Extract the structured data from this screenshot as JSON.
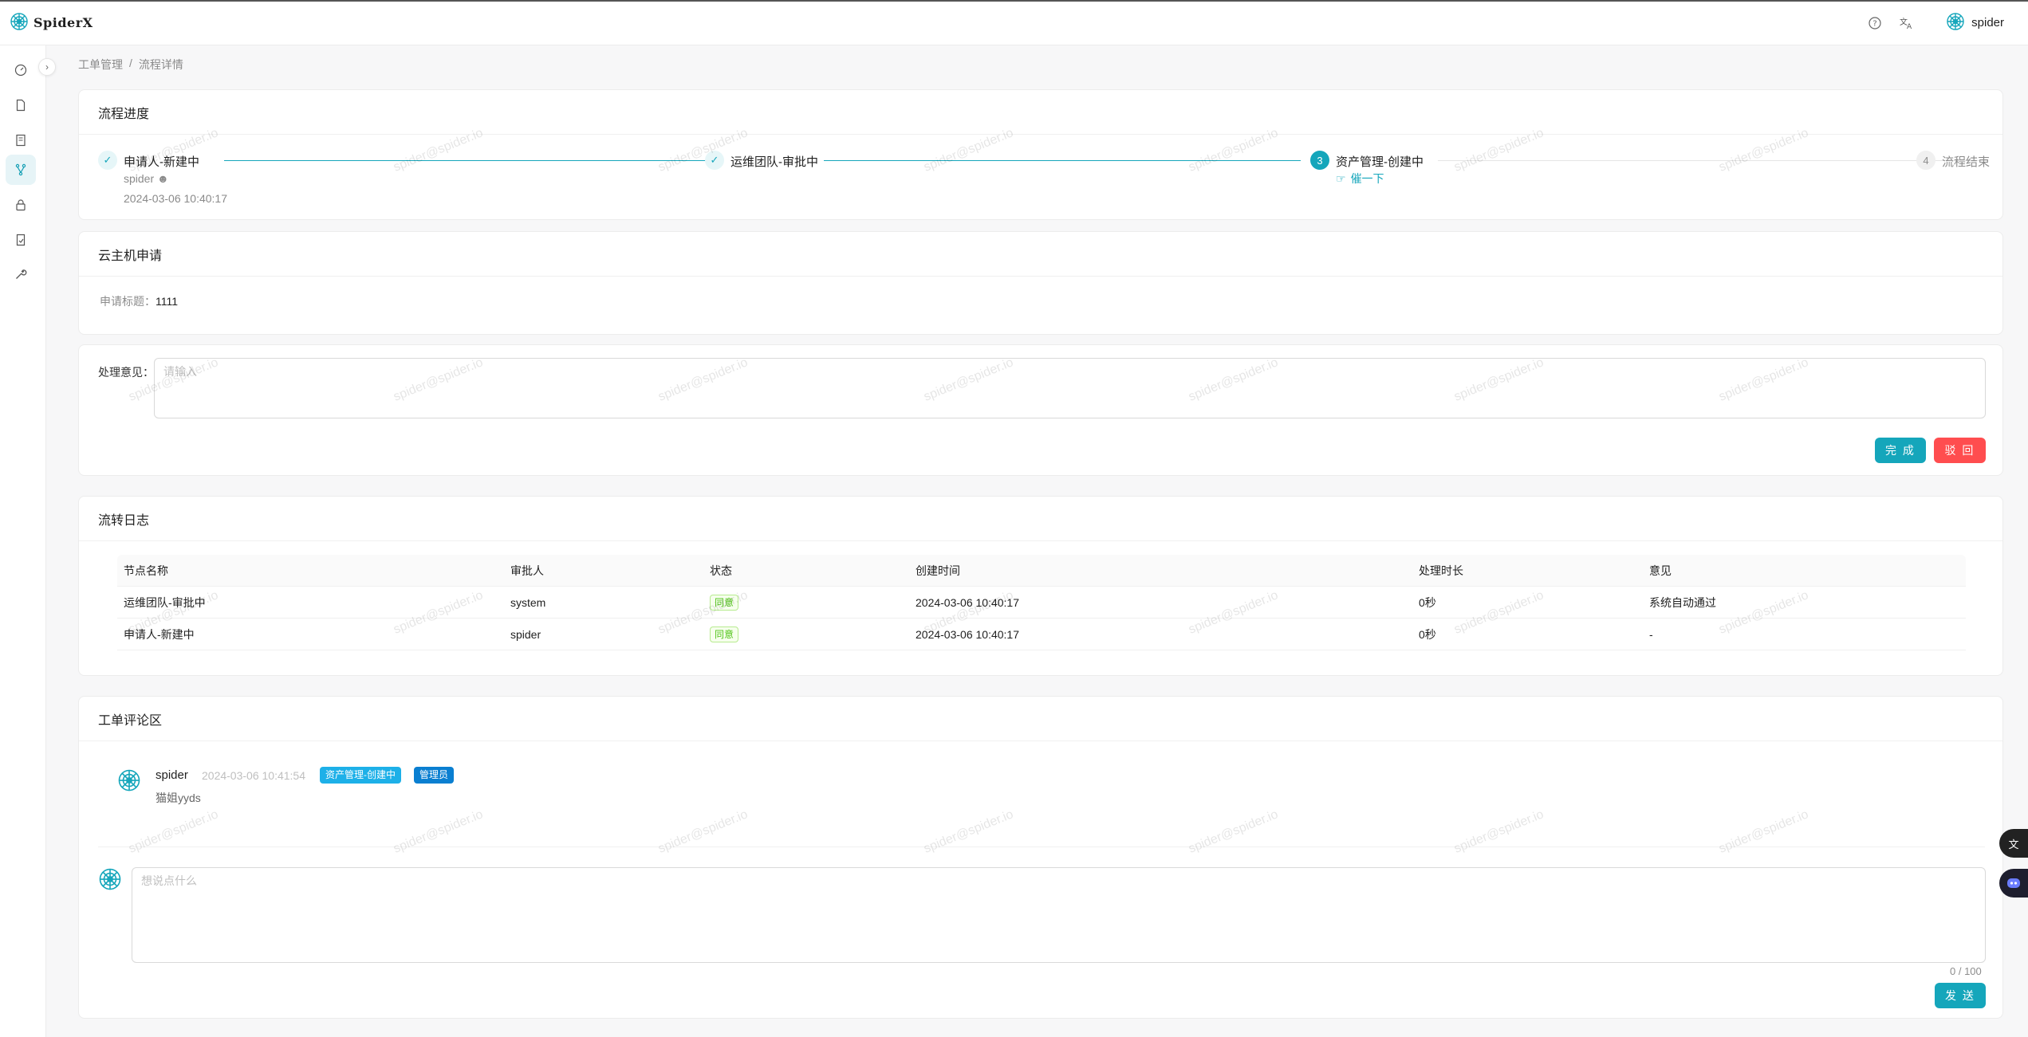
{
  "app": {
    "brand": "SpiderX",
    "user": "spider"
  },
  "breadcrumb": [
    "工单管理",
    "流程详情"
  ],
  "progress": {
    "title": "流程进度",
    "steps": [
      {
        "title": "申请人-新建中",
        "user": "spider",
        "time": "2024-03-06 10:40:17"
      },
      {
        "title": "运维团队-审批中"
      },
      {
        "number": "3",
        "title": "资产管理-创建中",
        "action": "催一下"
      },
      {
        "number": "4",
        "title": "流程结束"
      }
    ]
  },
  "application": {
    "title": "云主机申请",
    "field_label": "申请标题：",
    "field_value": "1111"
  },
  "opinion": {
    "label": "处理意见：",
    "placeholder": "请输入",
    "complete": "完 成",
    "reject": "驳 回"
  },
  "log": {
    "title": "流转日志",
    "columns": [
      "节点名称",
      "审批人",
      "状态",
      "创建时间",
      "处理时长",
      "意见"
    ],
    "rows": [
      [
        "运维团队-审批中",
        "system",
        "同意",
        "2024-03-06 10:40:17",
        "0秒",
        "系统自动通过"
      ],
      [
        "申请人-新建中",
        "spider",
        "同意",
        "2024-03-06 10:40:17",
        "0秒",
        "-"
      ]
    ]
  },
  "comments": {
    "title": "工单评论区",
    "items": [
      {
        "name": "spider",
        "time": "2024-03-06 10:41:54",
        "tags": [
          "资产管理-创建中",
          "管理员"
        ],
        "text": "猫姐yyds"
      }
    ],
    "placeholder": "想说点什么",
    "counter": "0 / 100",
    "send": "发 送"
  },
  "watermark": "spider@spider.io",
  "colors": {
    "accent": "#15a6bb",
    "danger": "#ff4d4f",
    "tag_blue": "#1db0e8",
    "tag_admin": "#0a7fd1"
  }
}
